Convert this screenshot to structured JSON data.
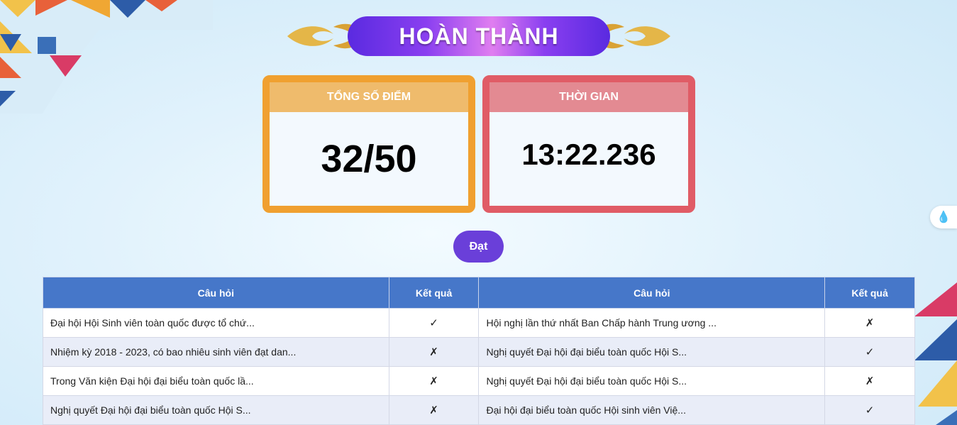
{
  "banner": {
    "title": "HOÀN THÀNH"
  },
  "score_card": {
    "label": "TỔNG SỐ ĐIỂM",
    "value": "32/50"
  },
  "time_card": {
    "label": "THỜI GIAN",
    "value": "13:22.236"
  },
  "result_button": {
    "label": "Đạt"
  },
  "table": {
    "headers": [
      "Câu hỏi",
      "Kết quả",
      "Câu hỏi",
      "Kết quả"
    ],
    "rows": [
      {
        "q1": "Đại hội Hội Sinh viên toàn quốc được tổ chứ...",
        "r1": "✓",
        "q2": "Hội nghị lần thứ nhất Ban Chấp hành Trung ương ...",
        "r2": "✗"
      },
      {
        "q1": "Nhiệm kỳ 2018 - 2023, có bao nhiêu sinh viên đạt dan...",
        "r1": "✗",
        "q2": "Nghị quyết Đại hội đại biểu toàn quốc Hội S...",
        "r2": "✓"
      },
      {
        "q1": "Trong Văn kiện Đại hội đại biểu toàn quốc lầ...",
        "r1": "✗",
        "q2": "Nghị quyết Đại hội đại biểu toàn quốc Hội S...",
        "r2": "✗"
      },
      {
        "q1": "Nghị quyết Đại hội đại biểu toàn quốc Hội S...",
        "r1": "✗",
        "q2": "Đại hội đại biểu toàn quốc Hội sinh viên Việ...",
        "r2": "✓"
      }
    ]
  },
  "colors": {
    "score": "#f0a030",
    "time": "#e05c66",
    "button": "#6a3fd9",
    "table_header": "#4677c9"
  }
}
